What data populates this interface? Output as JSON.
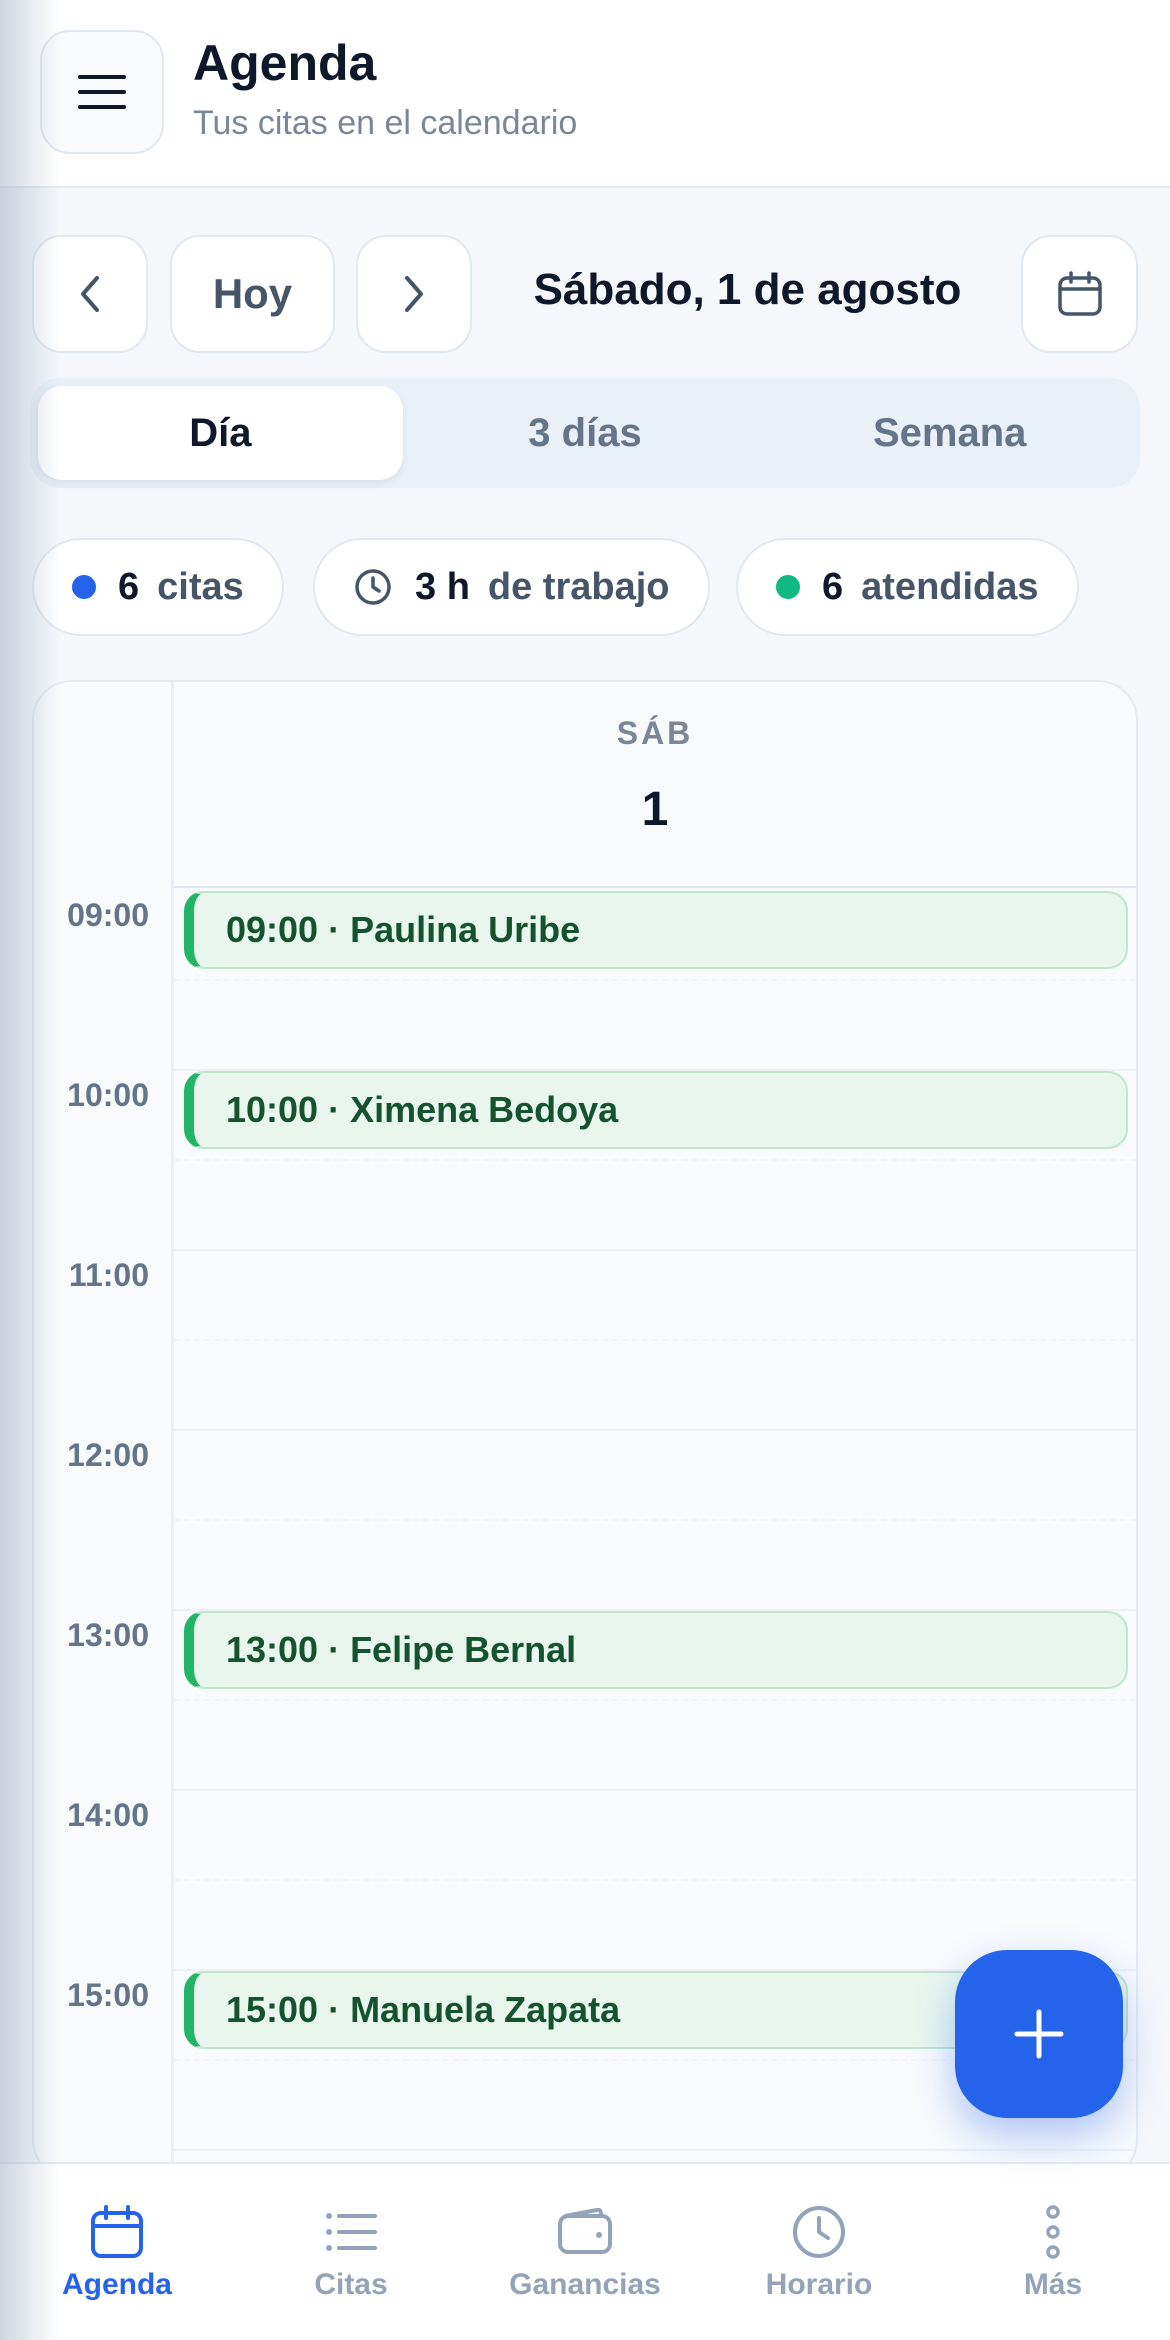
{
  "header": {
    "title": "Agenda",
    "subtitle": "Tus citas en el calendario"
  },
  "date_nav": {
    "today_label": "Hoy",
    "current_date": "Sábado, 1 de agosto"
  },
  "view_tabs": [
    {
      "label": "Día",
      "active": true
    },
    {
      "label": "3 días",
      "active": false
    },
    {
      "label": "Semana",
      "active": false
    }
  ],
  "stats": {
    "appointments": {
      "value": "6",
      "label": "citas",
      "color": "#2563eb"
    },
    "work_time": {
      "value": "3 h",
      "label": "de trabajo",
      "icon": "clock-icon"
    },
    "attended": {
      "value": "6",
      "label": "atendidas",
      "color": "#10b981"
    }
  },
  "calendar": {
    "day_name": "SÁB",
    "day_number": "1",
    "hours": [
      "09:00",
      "10:00",
      "11:00",
      "12:00",
      "13:00",
      "14:00",
      "15:00"
    ],
    "events": [
      {
        "label": "09:00 · Paulina Uribe",
        "hour": 9
      },
      {
        "label": "10:00 · Ximena Bedoya",
        "hour": 10
      },
      {
        "label": "13:00 · Felipe Bernal",
        "hour": 13
      },
      {
        "label": "15:00 · Manuela Zapata",
        "hour": 15
      }
    ],
    "event_color": "#22b565"
  },
  "fab": {
    "icon": "plus-icon"
  },
  "bottom_nav": [
    {
      "label": "Agenda",
      "icon": "calendar-icon",
      "active": true
    },
    {
      "label": "Citas",
      "icon": "list-icon",
      "active": false
    },
    {
      "label": "Ganancias",
      "icon": "wallet-icon",
      "active": false
    },
    {
      "label": "Horario",
      "icon": "clock-icon",
      "active": false
    },
    {
      "label": "Más",
      "icon": "more-vertical-icon",
      "active": false
    }
  ],
  "colors": {
    "accent": "#2563eb",
    "text_primary": "#0f172a",
    "text_muted": "#7b8798"
  }
}
